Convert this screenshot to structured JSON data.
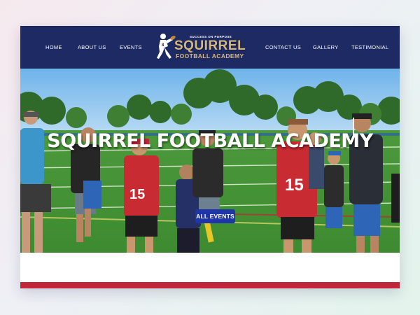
{
  "nav": {
    "items": [
      {
        "label": "HOME"
      },
      {
        "label": "ABOUT US"
      },
      {
        "label": "EVENTS"
      },
      {
        "label": "CONTACT US"
      },
      {
        "label": "GALLERY"
      },
      {
        "label": "TESTIMONIAL"
      }
    ]
  },
  "logo": {
    "tagline": "SUCCESS ON PURPOSE",
    "name": "SQUIRREL",
    "subtitle": "FOOTBALL ACADEMY",
    "icon": "football-player-icon"
  },
  "hero": {
    "title": "SQUIRREL FOOTBALL ACADEMY",
    "cta_label": "ALL EVENTS",
    "jersey_numbers": [
      "15",
      "15"
    ]
  },
  "colors": {
    "nav_bg": "#1d2a63",
    "logo_gold": "#d8b878",
    "cta_blue": "#2036a8",
    "accent_red": "#c1273a"
  }
}
